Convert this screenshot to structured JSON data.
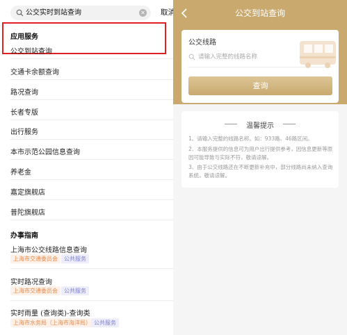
{
  "left": {
    "search": {
      "query": "公交实时到站查询",
      "cancel_label": "取消"
    },
    "app_section": {
      "title": "应用服务",
      "highlighted_item": "公交到站查询"
    },
    "app_items": [
      "交通卡余额查询",
      "路况查询",
      "长者专版",
      "出行服务",
      "本市示范公园信息查询",
      "养老金",
      "嘉定旗舰店",
      "普陀旗舰店"
    ],
    "guide_section": {
      "title": "办事指南"
    },
    "guide_items": [
      {
        "title": "上海市公交线路信息查询",
        "org": "上海市交通委员会",
        "type": "公共服务"
      },
      {
        "title": "实时路况查询",
        "org": "上海市交通委员会",
        "type": "公共服务"
      },
      {
        "title": "实时雨量 (查询类)-查询类",
        "org": "上海市水务局（上海市海洋局）",
        "type": "公共服务"
      }
    ]
  },
  "right": {
    "header_title": "公交到站查询",
    "card": {
      "label": "公交线路",
      "placeholder": "请输入完整的线路名称",
      "button_label": "查询"
    },
    "tips": {
      "title": "温馨提示",
      "items": [
        "1、请输入完整的线路名称。如：933路、46路区间。",
        "2、本服务提供的信息可为用户出行提供参考，因信息更新等原因可能导致与实际不符，敬请谅解。",
        "3、由于公交线路还在不断更新补充中，部分线路尚未纳入查询系统，敬请谅解。"
      ]
    }
  },
  "colors": {
    "accent": "#c9a96e",
    "highlight_border": "#e02020",
    "tag_org": "#e48a4a",
    "tag_public": "#7f7fd0"
  }
}
